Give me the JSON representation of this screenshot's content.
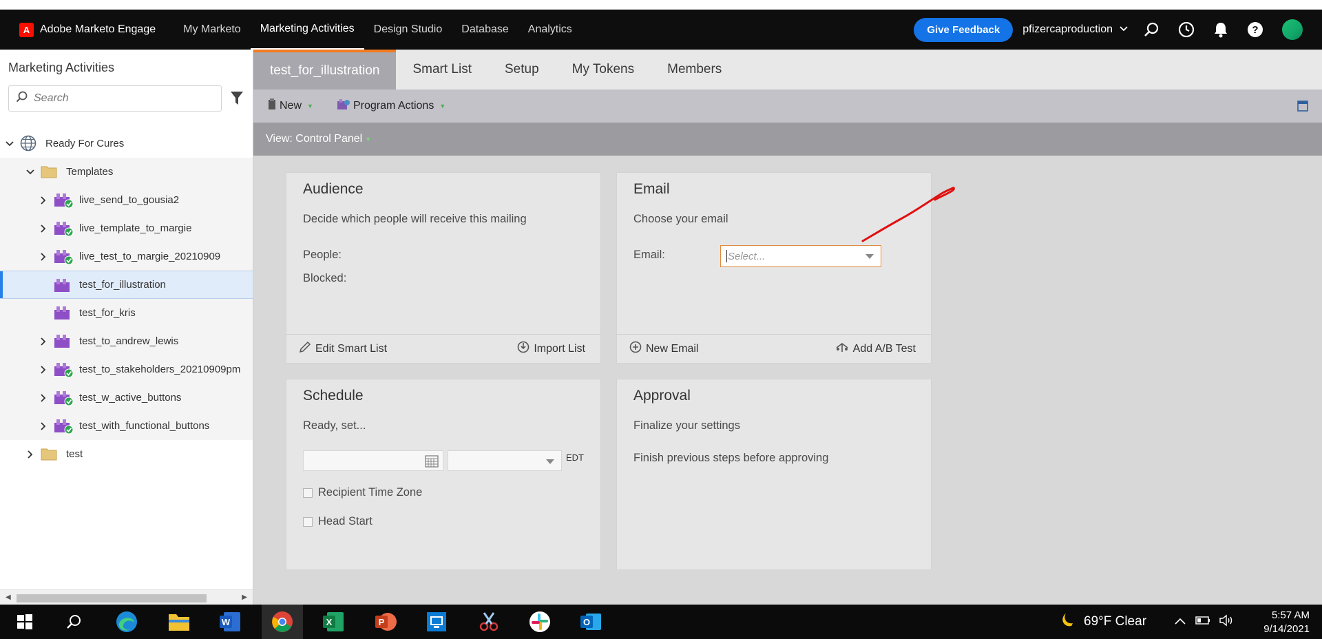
{
  "app": {
    "name": "Adobe Marketo Engage",
    "nav": [
      "My Marketo",
      "Marketing Activities",
      "Design Studio",
      "Database",
      "Analytics"
    ],
    "active_nav": "Marketing Activities",
    "feedback": "Give Feedback",
    "user": "pfizercaproduction"
  },
  "sidebar": {
    "title": "Marketing Activities",
    "search_placeholder": "Search",
    "tree": [
      {
        "label": "Ready For Cures",
        "level": 0,
        "expanded": true,
        "icon": "globe-icon"
      },
      {
        "label": "Templates",
        "level": 1,
        "expanded": true,
        "icon": "folder-icon"
      },
      {
        "label": "live_send_to_gousia2",
        "level": 2,
        "icon": "program-approved-icon"
      },
      {
        "label": "live_template_to_margie",
        "level": 2,
        "icon": "program-approved-icon"
      },
      {
        "label": "live_test_to_margie_20210909",
        "level": 2,
        "icon": "program-approved-icon"
      },
      {
        "label": "test_for_illustration",
        "level": 2,
        "icon": "program-icon",
        "selected": true
      },
      {
        "label": "test_for_kris",
        "level": 2,
        "icon": "program-icon"
      },
      {
        "label": "test_to_andrew_lewis",
        "level": 2,
        "icon": "program-icon"
      },
      {
        "label": "test_to_stakeholders_20210909pm",
        "level": 2,
        "icon": "program-approved-icon"
      },
      {
        "label": "test_w_active_buttons",
        "level": 2,
        "icon": "program-approved-icon"
      },
      {
        "label": "test_with_functional_buttons",
        "level": 2,
        "icon": "program-approved-icon"
      },
      {
        "label": "test",
        "level": 1,
        "icon": "folder-icon"
      }
    ]
  },
  "main": {
    "tabs": [
      "test_for_illustration",
      "Smart List",
      "Setup",
      "My Tokens",
      "Members"
    ],
    "toolbar": {
      "new": "New",
      "program_actions": "Program Actions"
    },
    "view": "View: Control Panel",
    "cards": {
      "audience": {
        "title": "Audience",
        "desc": "Decide which people will receive this mailing",
        "people": "People:",
        "blocked": "Blocked:",
        "edit_smart_list": "Edit Smart List",
        "import_list": "Import List"
      },
      "email": {
        "title": "Email",
        "desc": "Choose your email",
        "label": "Email:",
        "select_placeholder": "Select...",
        "new_email": "New Email",
        "add_ab": "Add A/B Test"
      },
      "schedule": {
        "title": "Schedule",
        "desc": "Ready, set...",
        "timezone": "EDT",
        "recipient_tz": "Recipient Time Zone",
        "head_start": "Head Start"
      },
      "approval": {
        "title": "Approval",
        "desc": "Finalize your settings",
        "note": "Finish previous steps before approving"
      }
    }
  },
  "taskbar": {
    "weather": "69°F  Clear",
    "time": "5:57 AM",
    "date": "9/14/2021"
  },
  "colors": {
    "accent_orange": "#f47b20",
    "feedback_blue": "#1473e6",
    "annotation_red": "#e01010"
  }
}
